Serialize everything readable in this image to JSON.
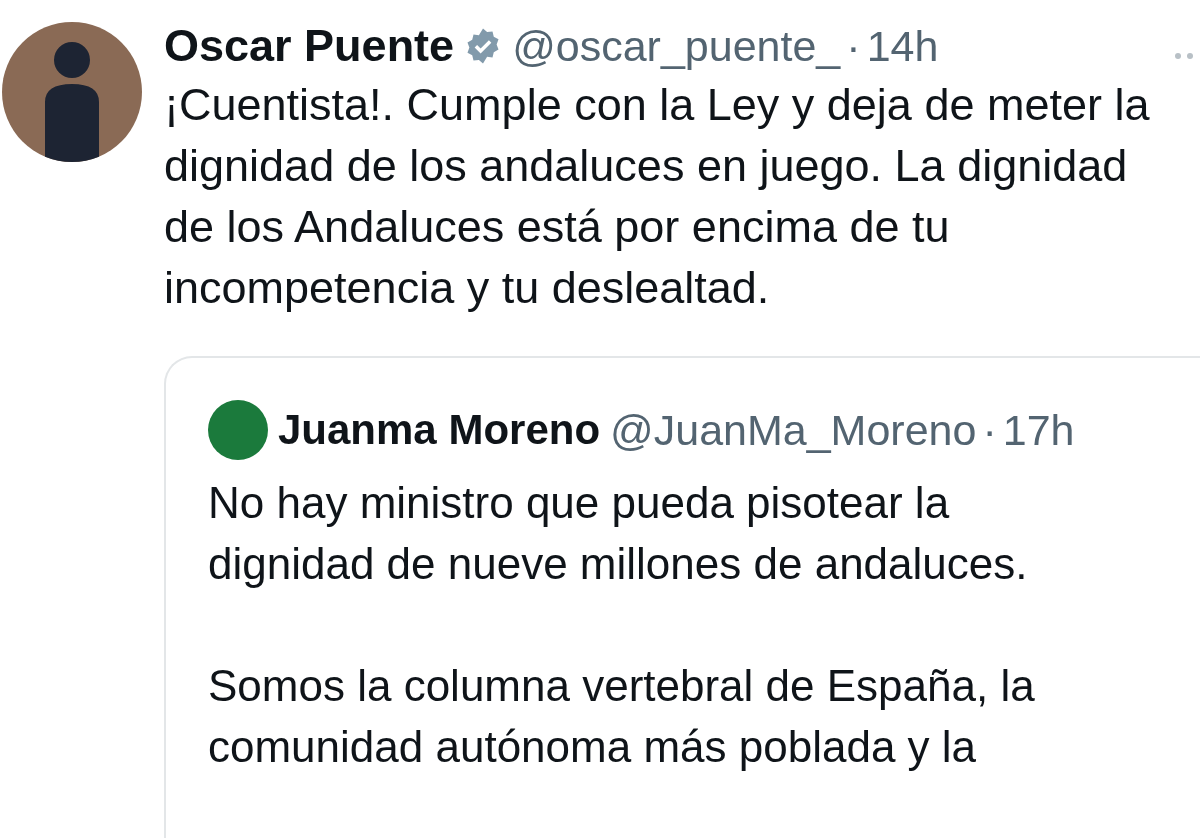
{
  "tweet": {
    "author": {
      "name": "Oscar Puente",
      "verified": true,
      "handle": "@oscar_puente_",
      "separator": "·",
      "time": "14h"
    },
    "text": "¡Cuentista!. Cumple con la Ley y deja de meter la\ndignidad de los andaluces en juego. La dignidad\nde los Andaluces está por encima de tu\nincompetencia y tu deslealtad.",
    "quoted": {
      "author": {
        "name": "Juanma Moreno",
        "handle": "@JuanMa_Moreno",
        "separator": "·",
        "time": "17h"
      },
      "paragraphs": [
        "No hay ministro que pueda pisotear la\ndignidad de nueve millones de andaluces.",
        "Somos la columna vertebral de España, la\ncomunidad autónoma más poblada y la"
      ]
    }
  }
}
